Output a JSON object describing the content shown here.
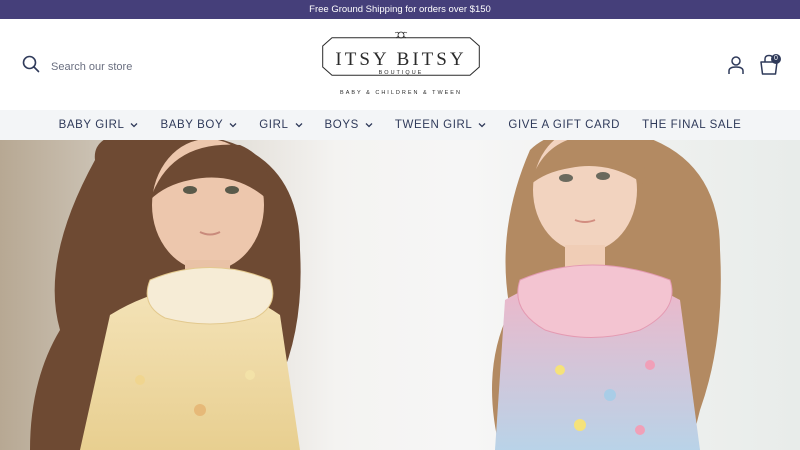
{
  "announcement": "Free Ground Shipping for orders over $150",
  "header": {
    "search_placeholder": "Search our store",
    "logo": {
      "title": "ITSY BITSY",
      "subtitle": "BOUTIQUE",
      "tagline": "BABY & CHILDREN & TWEEN"
    },
    "cart_count": "0",
    "icons": [
      "search-icon",
      "account-icon",
      "cart-icon"
    ]
  },
  "nav": {
    "items": [
      {
        "label": "BABY GIRL",
        "dropdown": true
      },
      {
        "label": "BABY BOY",
        "dropdown": true
      },
      {
        "label": "GIRL",
        "dropdown": true
      },
      {
        "label": "BOYS",
        "dropdown": true
      },
      {
        "label": "TWEEN GIRL",
        "dropdown": true
      },
      {
        "label": "GIVE A GIFT CARD",
        "dropdown": false
      },
      {
        "label": "THE FINAL SALE",
        "dropdown": false
      }
    ]
  },
  "colors": {
    "announcement_bg": "#453f7a",
    "nav_bg": "#f3f5f7",
    "text": "#2f3a5a"
  }
}
